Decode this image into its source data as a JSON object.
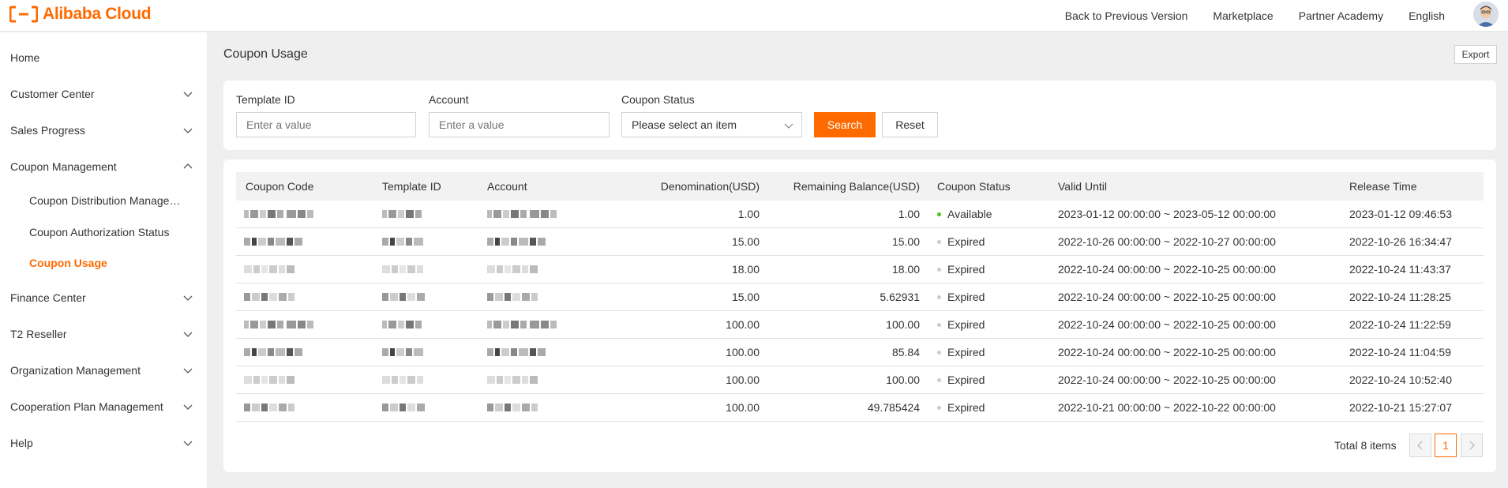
{
  "header": {
    "brand": "Alibaba Cloud",
    "brand_color": "#ff6a00",
    "nav": [
      "Back to Previous Version",
      "Marketplace",
      "Partner Academy",
      "English"
    ]
  },
  "sidebar": {
    "items": [
      {
        "label": "Home",
        "expandable": false
      },
      {
        "label": "Customer Center",
        "expandable": true,
        "expanded": false
      },
      {
        "label": "Sales Progress",
        "expandable": true,
        "expanded": false
      },
      {
        "label": "Coupon Management",
        "expandable": true,
        "expanded": true
      },
      {
        "label": "Finance Center",
        "expandable": true,
        "expanded": false
      },
      {
        "label": "T2 Reseller",
        "expandable": true,
        "expanded": false
      },
      {
        "label": "Organization Management",
        "expandable": true,
        "expanded": false
      },
      {
        "label": "Cooperation Plan Management",
        "expandable": true,
        "expanded": false
      },
      {
        "label": "Help",
        "expandable": true,
        "expanded": false
      }
    ],
    "coupon_sub": [
      {
        "label": "Coupon Distribution Management",
        "active": false
      },
      {
        "label": "Coupon Authorization Status",
        "active": false
      },
      {
        "label": "Coupon Usage",
        "active": true
      }
    ]
  },
  "page": {
    "title": "Coupon Usage",
    "export_label": "Export"
  },
  "filters": {
    "template_id": {
      "label": "Template ID",
      "placeholder": "Enter a value",
      "value": ""
    },
    "account": {
      "label": "Account",
      "placeholder": "Enter a value",
      "value": ""
    },
    "status": {
      "label": "Coupon Status",
      "value": "Please select an item"
    },
    "search_label": "Search",
    "reset_label": "Reset"
  },
  "table": {
    "columns": [
      "Coupon Code",
      "Template ID",
      "Account",
      "Denomination(USD)",
      "Remaining Balance(USD)",
      "Coupon Status",
      "Valid Until",
      "Release Time"
    ],
    "rows": [
      {
        "denomination": "1.00",
        "remaining": "1.00",
        "status": "Available",
        "valid_until": "2023-01-12 00:00:00 ~ 2023-05-12 00:00:00",
        "release_time": "2023-01-12 09:46:53"
      },
      {
        "denomination": "15.00",
        "remaining": "15.00",
        "status": "Expired",
        "valid_until": "2022-10-26 00:00:00 ~ 2022-10-27 00:00:00",
        "release_time": "2022-10-26 16:34:47"
      },
      {
        "denomination": "18.00",
        "remaining": "18.00",
        "status": "Expired",
        "valid_until": "2022-10-24 00:00:00 ~ 2022-10-25 00:00:00",
        "release_time": "2022-10-24 11:43:37"
      },
      {
        "denomination": "15.00",
        "remaining": "5.62931",
        "status": "Expired",
        "valid_until": "2022-10-24 00:00:00 ~ 2022-10-25 00:00:00",
        "release_time": "2022-10-24 11:28:25"
      },
      {
        "denomination": "100.00",
        "remaining": "100.00",
        "status": "Expired",
        "valid_until": "2022-10-24 00:00:00 ~ 2022-10-25 00:00:00",
        "release_time": "2022-10-24 11:22:59"
      },
      {
        "denomination": "100.00",
        "remaining": "85.84",
        "status": "Expired",
        "valid_until": "2022-10-24 00:00:00 ~ 2022-10-25 00:00:00",
        "release_time": "2022-10-24 11:04:59"
      },
      {
        "denomination": "100.00",
        "remaining": "100.00",
        "status": "Expired",
        "valid_until": "2022-10-24 00:00:00 ~ 2022-10-25 00:00:00",
        "release_time": "2022-10-24 10:52:40"
      },
      {
        "denomination": "100.00",
        "remaining": "49.785424",
        "status": "Expired",
        "valid_until": "2022-10-21 00:00:00 ~ 2022-10-22 00:00:00",
        "release_time": "2022-10-21 15:27:07"
      }
    ],
    "status_colors": {
      "Available": "#52c41a",
      "Expired": "#cccccc"
    }
  },
  "pagination": {
    "total_label": "Total 8 items",
    "current_page": "1",
    "prev_icon": "chevron-left-icon",
    "next_icon": "chevron-right-icon"
  }
}
